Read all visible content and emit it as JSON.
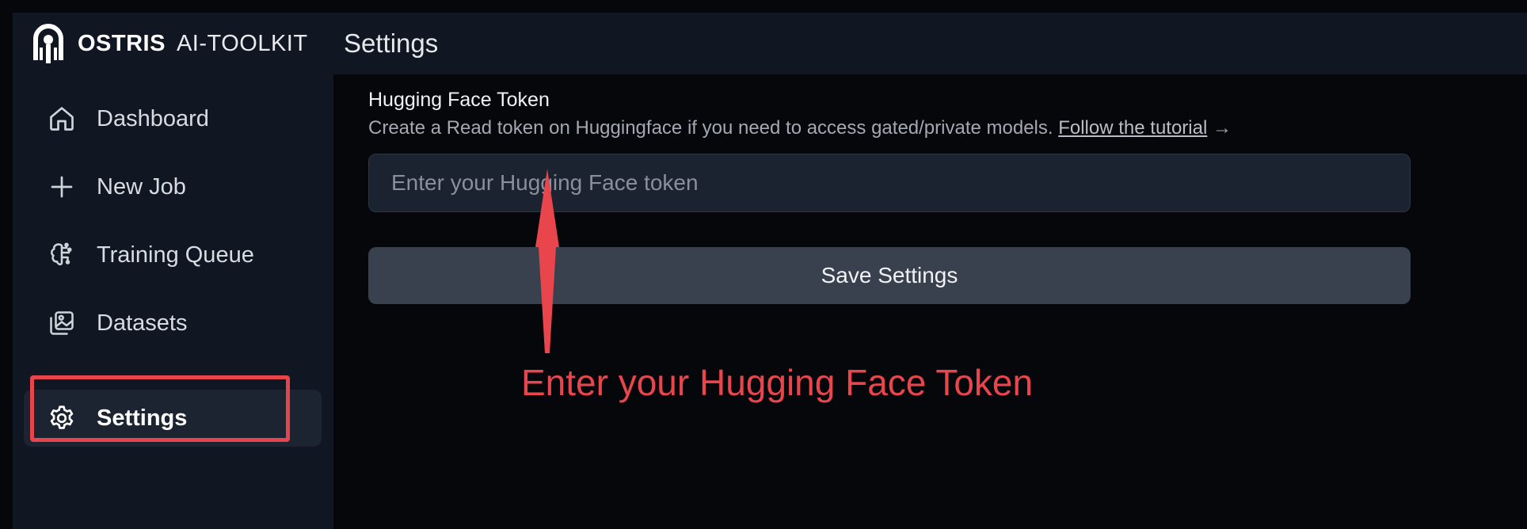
{
  "app": {
    "brand_bold": "OSTRIS",
    "brand_light": "AI-TOOLKIT"
  },
  "header": {
    "title": "Settings"
  },
  "sidebar": {
    "items": [
      {
        "label": "Dashboard",
        "icon": "home-icon",
        "active": false
      },
      {
        "label": "New Job",
        "icon": "plus-icon",
        "active": false
      },
      {
        "label": "Training Queue",
        "icon": "brain-icon",
        "active": false
      },
      {
        "label": "Datasets",
        "icon": "images-icon",
        "active": false
      },
      {
        "label": "Settings",
        "icon": "gear-icon",
        "active": true
      }
    ]
  },
  "settings": {
    "token_label": "Hugging Face Token",
    "token_help": "Create a Read token on Huggingface if you need to access gated/private models.",
    "tutorial_link": "Follow the tutorial",
    "tutorial_arrow": "→",
    "token_value": "",
    "token_placeholder": "Enter your Hugging Face token",
    "save_label": "Save Settings"
  },
  "annotation": {
    "text": "Enter your Hugging Face Token",
    "color": "#e9454d"
  },
  "colors": {
    "background": "#05070b",
    "sidebar": "#111722",
    "highlight": "#e5454b",
    "button": "#3a414e"
  }
}
